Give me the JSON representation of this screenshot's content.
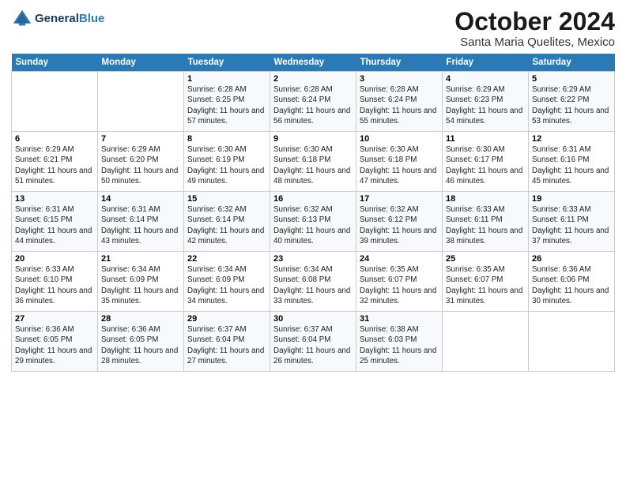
{
  "header": {
    "logo_general": "General",
    "logo_blue": "Blue",
    "month": "October 2024",
    "location": "Santa Maria Quelites, Mexico"
  },
  "weekdays": [
    "Sunday",
    "Monday",
    "Tuesday",
    "Wednesday",
    "Thursday",
    "Friday",
    "Saturday"
  ],
  "weeks": [
    [
      {
        "day": "",
        "info": ""
      },
      {
        "day": "",
        "info": ""
      },
      {
        "day": "1",
        "info": "Sunrise: 6:28 AM\nSunset: 6:25 PM\nDaylight: 11 hours and 57 minutes."
      },
      {
        "day": "2",
        "info": "Sunrise: 6:28 AM\nSunset: 6:24 PM\nDaylight: 11 hours and 56 minutes."
      },
      {
        "day": "3",
        "info": "Sunrise: 6:28 AM\nSunset: 6:24 PM\nDaylight: 11 hours and 55 minutes."
      },
      {
        "day": "4",
        "info": "Sunrise: 6:29 AM\nSunset: 6:23 PM\nDaylight: 11 hours and 54 minutes."
      },
      {
        "day": "5",
        "info": "Sunrise: 6:29 AM\nSunset: 6:22 PM\nDaylight: 11 hours and 53 minutes."
      }
    ],
    [
      {
        "day": "6",
        "info": "Sunrise: 6:29 AM\nSunset: 6:21 PM\nDaylight: 11 hours and 51 minutes."
      },
      {
        "day": "7",
        "info": "Sunrise: 6:29 AM\nSunset: 6:20 PM\nDaylight: 11 hours and 50 minutes."
      },
      {
        "day": "8",
        "info": "Sunrise: 6:30 AM\nSunset: 6:19 PM\nDaylight: 11 hours and 49 minutes."
      },
      {
        "day": "9",
        "info": "Sunrise: 6:30 AM\nSunset: 6:18 PM\nDaylight: 11 hours and 48 minutes."
      },
      {
        "day": "10",
        "info": "Sunrise: 6:30 AM\nSunset: 6:18 PM\nDaylight: 11 hours and 47 minutes."
      },
      {
        "day": "11",
        "info": "Sunrise: 6:30 AM\nSunset: 6:17 PM\nDaylight: 11 hours and 46 minutes."
      },
      {
        "day": "12",
        "info": "Sunrise: 6:31 AM\nSunset: 6:16 PM\nDaylight: 11 hours and 45 minutes."
      }
    ],
    [
      {
        "day": "13",
        "info": "Sunrise: 6:31 AM\nSunset: 6:15 PM\nDaylight: 11 hours and 44 minutes."
      },
      {
        "day": "14",
        "info": "Sunrise: 6:31 AM\nSunset: 6:14 PM\nDaylight: 11 hours and 43 minutes."
      },
      {
        "day": "15",
        "info": "Sunrise: 6:32 AM\nSunset: 6:14 PM\nDaylight: 11 hours and 42 minutes."
      },
      {
        "day": "16",
        "info": "Sunrise: 6:32 AM\nSunset: 6:13 PM\nDaylight: 11 hours and 40 minutes."
      },
      {
        "day": "17",
        "info": "Sunrise: 6:32 AM\nSunset: 6:12 PM\nDaylight: 11 hours and 39 minutes."
      },
      {
        "day": "18",
        "info": "Sunrise: 6:33 AM\nSunset: 6:11 PM\nDaylight: 11 hours and 38 minutes."
      },
      {
        "day": "19",
        "info": "Sunrise: 6:33 AM\nSunset: 6:11 PM\nDaylight: 11 hours and 37 minutes."
      }
    ],
    [
      {
        "day": "20",
        "info": "Sunrise: 6:33 AM\nSunset: 6:10 PM\nDaylight: 11 hours and 36 minutes."
      },
      {
        "day": "21",
        "info": "Sunrise: 6:34 AM\nSunset: 6:09 PM\nDaylight: 11 hours and 35 minutes."
      },
      {
        "day": "22",
        "info": "Sunrise: 6:34 AM\nSunset: 6:09 PM\nDaylight: 11 hours and 34 minutes."
      },
      {
        "day": "23",
        "info": "Sunrise: 6:34 AM\nSunset: 6:08 PM\nDaylight: 11 hours and 33 minutes."
      },
      {
        "day": "24",
        "info": "Sunrise: 6:35 AM\nSunset: 6:07 PM\nDaylight: 11 hours and 32 minutes."
      },
      {
        "day": "25",
        "info": "Sunrise: 6:35 AM\nSunset: 6:07 PM\nDaylight: 11 hours and 31 minutes."
      },
      {
        "day": "26",
        "info": "Sunrise: 6:36 AM\nSunset: 6:06 PM\nDaylight: 11 hours and 30 minutes."
      }
    ],
    [
      {
        "day": "27",
        "info": "Sunrise: 6:36 AM\nSunset: 6:05 PM\nDaylight: 11 hours and 29 minutes."
      },
      {
        "day": "28",
        "info": "Sunrise: 6:36 AM\nSunset: 6:05 PM\nDaylight: 11 hours and 28 minutes."
      },
      {
        "day": "29",
        "info": "Sunrise: 6:37 AM\nSunset: 6:04 PM\nDaylight: 11 hours and 27 minutes."
      },
      {
        "day": "30",
        "info": "Sunrise: 6:37 AM\nSunset: 6:04 PM\nDaylight: 11 hours and 26 minutes."
      },
      {
        "day": "31",
        "info": "Sunrise: 6:38 AM\nSunset: 6:03 PM\nDaylight: 11 hours and 25 minutes."
      },
      {
        "day": "",
        "info": ""
      },
      {
        "day": "",
        "info": ""
      }
    ]
  ]
}
